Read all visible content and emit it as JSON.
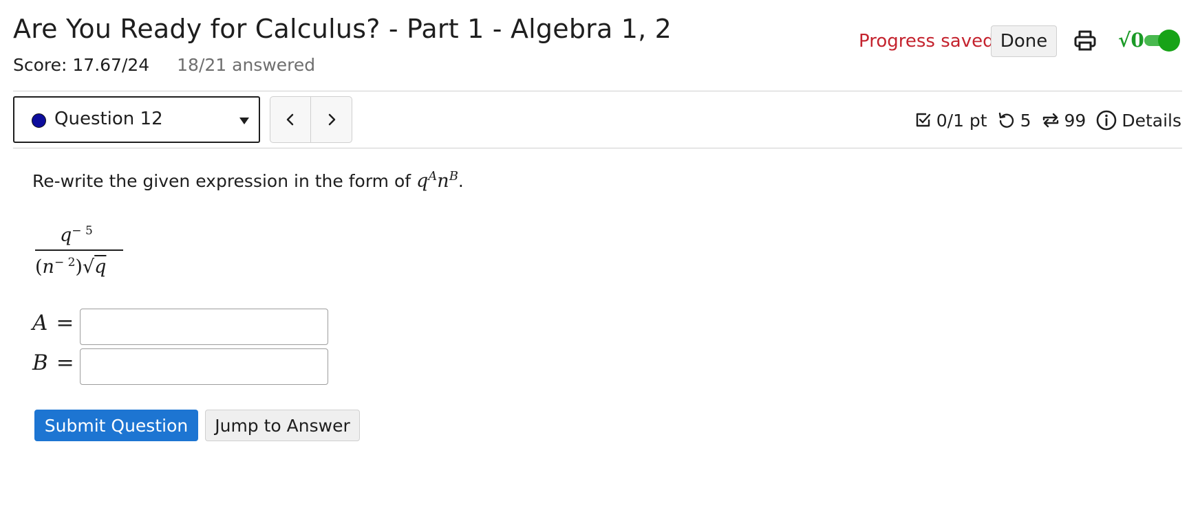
{
  "header": {
    "title": "Are You Ready for Calculus? - Part 1 - Algebra 1, 2",
    "score": "Score: 17.67/24",
    "answered": "18/21 answered",
    "progress_status": "Progress saved",
    "done_label": "Done",
    "print_icon": "print-icon",
    "math_toggle_glyph": "√0",
    "math_toggle_on": true
  },
  "question_nav": {
    "selected_question": "Question 12",
    "prev_icon": "chevron-left-icon",
    "next_icon": "chevron-right-icon"
  },
  "meta": {
    "points": "0/1 pt",
    "retries": "5",
    "attempts": "99",
    "details_label": "Details"
  },
  "question": {
    "prompt_text": "Re-write the given expression in the form of ",
    "prompt_base1": "q",
    "prompt_exp1": "A",
    "prompt_base2": "n",
    "prompt_exp2": "B",
    "prompt_end": ".",
    "numerator_base": "q",
    "numerator_exp": "− 5",
    "denominator_open": "(",
    "denominator_base": "n",
    "denominator_exp": "− 2",
    "denominator_close": ")",
    "denominator_sqrt_sign": "√",
    "denominator_sqrt_arg": "q",
    "var_a": "A",
    "var_b": "B",
    "equals": "=",
    "input_a_value": "",
    "input_b_value": ""
  },
  "actions": {
    "submit_label": "Submit Question",
    "jump_label": "Jump to Answer"
  },
  "colors": {
    "accent_blue": "#1d75d2",
    "progress_red": "#c4232e",
    "toggle_green": "#17a317",
    "question_dot": "#0d0d9c"
  }
}
